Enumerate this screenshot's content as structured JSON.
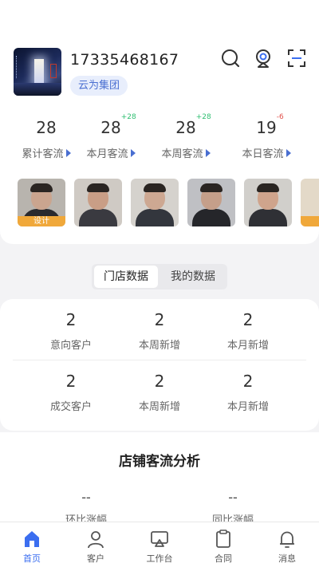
{
  "header": {
    "phone": "17335468167",
    "group": "云为集团"
  },
  "stats": [
    {
      "value": "28",
      "delta": "",
      "label": "累计客流"
    },
    {
      "value": "28",
      "delta": "+28",
      "label": "本月客流"
    },
    {
      "value": "28",
      "delta": "+28",
      "label": "本周客流"
    },
    {
      "value": "19",
      "delta": "-6",
      "label": "本日客流"
    }
  ],
  "faces": [
    {
      "tag": "设计"
    },
    {
      "tag": ""
    },
    {
      "tag": ""
    },
    {
      "tag": ""
    },
    {
      "tag": ""
    }
  ],
  "tabs": {
    "store": "门店数据",
    "mine": "我的数据"
  },
  "metrics": {
    "row1": [
      {
        "value": "2",
        "label": "意向客户"
      },
      {
        "value": "2",
        "label": "本周新增"
      },
      {
        "value": "2",
        "label": "本月新增"
      }
    ],
    "row2": [
      {
        "value": "2",
        "label": "成交客户"
      },
      {
        "value": "2",
        "label": "本周新增"
      },
      {
        "value": "2",
        "label": "本月新增"
      }
    ]
  },
  "analysis": {
    "title": "店铺客流分析",
    "left": {
      "value": "--",
      "label": "环比涨幅"
    },
    "right": {
      "value": "--",
      "label": "同比涨幅"
    }
  },
  "nav": [
    {
      "label": "首页",
      "icon": "home-icon",
      "active": true
    },
    {
      "label": "客户",
      "icon": "user-icon",
      "active": false
    },
    {
      "label": "工作台",
      "icon": "workbench-icon",
      "active": false
    },
    {
      "label": "合同",
      "icon": "contract-icon",
      "active": false
    },
    {
      "label": "消息",
      "icon": "bell-icon",
      "active": false
    }
  ],
  "colors": {
    "accent": "#3b6ef0",
    "up": "#2fbf71",
    "down": "#e2504a",
    "tag": "#f0a83a"
  }
}
